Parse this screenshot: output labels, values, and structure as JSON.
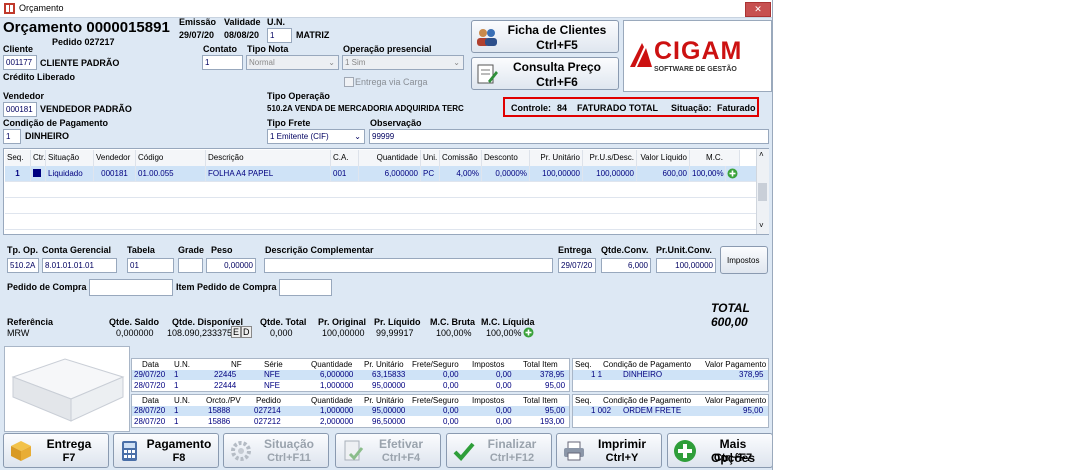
{
  "window": {
    "title": "Orçamento",
    "close_label": "✕"
  },
  "header": {
    "title": "Orçamento 0000015891",
    "order_label": "Pedido 027217",
    "emissao_label": "Emissão",
    "emissao": "29/07/20",
    "validade_label": "Validade",
    "validade": "08/08/20",
    "un_label": "U.N.",
    "un": "1",
    "un_name": "MATRIZ"
  },
  "cliente": {
    "label": "Cliente",
    "code": "001177",
    "name": "CLIENTE PADRÃO",
    "credit": "Crédito Liberado"
  },
  "contato": {
    "label": "Contato",
    "value": "1"
  },
  "tipo_nota": {
    "label": "Tipo Nota",
    "value": "Normal"
  },
  "operacao": {
    "label": "Operação presencial",
    "value": "1 Sim",
    "entrega_label": "Entrega via Carga"
  },
  "buttons_top": {
    "ficha_l1": "Ficha de Clientes",
    "ficha_l2": "Ctrl+F5",
    "consulta_l1": "Consulta Preço",
    "consulta_l2": "Ctrl+F6"
  },
  "logo": {
    "name": "CIGAM",
    "tagline": "SOFTWARE DE GESTÃO"
  },
  "vendedor": {
    "label": "Vendedor",
    "code": "000181",
    "name": "VENDEDOR PADRÃO"
  },
  "tipo_operacao": {
    "label": "Tipo Operação",
    "value": "510.2A  VENDA DE MERCADORIA ADQUIRIDA TERC"
  },
  "status": {
    "controle_label": "Controle:",
    "controle": "84",
    "state": "FATURADO TOTAL",
    "situacao_label": "Situação:",
    "situacao": "Faturado",
    "color": "#e00000"
  },
  "condicao": {
    "label": "Condição de Pagamento",
    "code": "1",
    "name": "DINHEIRO"
  },
  "tipo_frete": {
    "label": "Tipo Frete",
    "value": "1 Emitente (CIF)"
  },
  "observacao": {
    "label": "Observação",
    "value": "99999"
  },
  "items_grid": {
    "headers": [
      "Seq.",
      "Ctr.",
      "Situação",
      "Vendedor",
      "Código",
      "Descrição",
      "C.A.",
      "Quantidade",
      "Uni.",
      "Comissão",
      "Desconto",
      "Pr. Unitário",
      "Pr.U.s/Desc.",
      "Valor Líquido",
      "M.C."
    ],
    "row": [
      "1",
      "",
      "Liquidado",
      "000181",
      "01.00.055",
      "FOLHA A4 PAPEL",
      "001",
      "6,000000",
      "PC",
      "4,00%",
      "0,0000%",
      "100,00000",
      "100,00000",
      "600,00",
      "100,00%"
    ],
    "selected_color": "#cfe3f7"
  },
  "detail": {
    "tp_op_label": "Tp. Op.",
    "tp_op": "510.2A",
    "conta_label": "Conta Gerencial",
    "conta": "8.01.01.01.01",
    "tabela_label": "Tabela",
    "tabela": "01",
    "grade_label": "Grade",
    "peso_label": "Peso",
    "peso": "0,00000",
    "desc_label": "Descrição Complementar",
    "entrega_label": "Entrega",
    "entrega": "29/07/20",
    "qtde_conv_label": "Qtde.Conv.",
    "qtde_conv": "6,000",
    "pr_unit_conv_label": "Pr.Unit.Conv.",
    "pr_unit_conv": "100,00000",
    "impostos_label": "Impostos",
    "pedido_compra_label": "Pedido de Compra",
    "item_pedido_label": "Item Pedido de Compra"
  },
  "totals": {
    "total_label": "TOTAL",
    "total_value": "600,00",
    "referencia_label": "Referência",
    "referencia": "MRW",
    "saldo_label": "Qtde. Saldo",
    "saldo": "0,000000",
    "disponivel_label": "Qtde. Disponível",
    "disponivel": "108.090,233375",
    "e_label": "E",
    "d_label": "D",
    "qtde_total_label": "Qtde. Total",
    "qtde_total": "0,000",
    "pr_original_label": "Pr. Original",
    "pr_original": "100,00000",
    "pr_liquido_label": "Pr. Líquido",
    "pr_liquido": "99,99917",
    "mc_bruta_label": "M.C. Bruta",
    "mc_bruta": "100,00%",
    "mc_liquida_label": "M.C. Líquida",
    "mc_liquida": "100,00%"
  },
  "nf_grid": {
    "headers": [
      "Data",
      "U.N.",
      "NF",
      "Série",
      "Quantidade",
      "Pr. Unitário",
      "Frete/Seguro",
      "Impostos",
      "Total Item"
    ],
    "rows": [
      [
        "29/07/20",
        "1",
        "22445",
        "NFE",
        "6,000000",
        "63,15833",
        "0,00",
        "0,00",
        "378,95"
      ],
      [
        "28/07/20",
        "1",
        "22444",
        "NFE",
        "1,000000",
        "95,00000",
        "0,00",
        "0,00",
        "95,00"
      ]
    ]
  },
  "nf_pay": {
    "headers": [
      "Seq.",
      "Condição de Pagamento",
      "Valor Pagamento"
    ],
    "row": [
      "1 1",
      "DINHEIRO",
      "378,95"
    ]
  },
  "orc_grid": {
    "headers": [
      "Data",
      "U.N.",
      "Orcto./PV",
      "Pedido",
      "Quantidade",
      "Pr. Unitário",
      "Frete/Seguro",
      "Impostos",
      "Total Item"
    ],
    "rows": [
      [
        "28/07/20",
        "1",
        "15888",
        "027214",
        "1,000000",
        "95,00000",
        "0,00",
        "0,00",
        "95,00"
      ],
      [
        "28/07/20",
        "1",
        "15886",
        "027212",
        "2,000000",
        "96,50000",
        "0,00",
        "0,00",
        "193,00"
      ]
    ]
  },
  "orc_pay": {
    "headers": [
      "Seq.",
      "Condição de Pagamento",
      "Valor Pagamento"
    ],
    "row": [
      "1 002",
      "ORDEM FRETE",
      "95,00"
    ]
  },
  "bottom": {
    "entrega_l1": "Entrega",
    "entrega_l2": "F7",
    "pagamento_l1": "Pagamento",
    "pagamento_l2": "F8",
    "situacao_l1": "Situação",
    "situacao_l2": "Ctrl+F11",
    "efetivar_l1": "Efetivar",
    "efetivar_l2": "Ctrl+F4",
    "finalizar_l1": "Finalizar",
    "finalizar_l2": "Ctrl+F12",
    "imprimir_l1": "Imprimir",
    "imprimir_l2": "Ctrl+Y",
    "opcoes_l1": "Mais Opções",
    "opcoes_l2": "Ctrl+F7"
  }
}
